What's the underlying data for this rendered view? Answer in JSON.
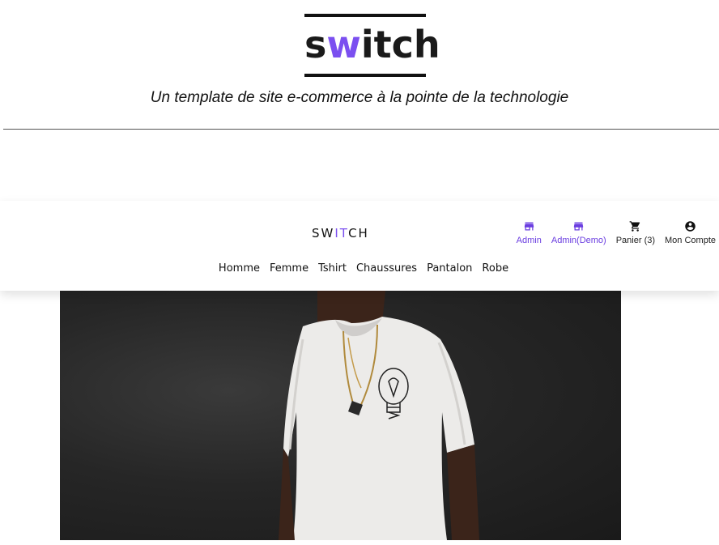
{
  "hero": {
    "logo_prefix": "s",
    "logo_accent": "w",
    "logo_suffix": "itch",
    "tagline": "Un template de site e-commerce à la pointe de la technologie"
  },
  "header": {
    "brand_prefix": "SW",
    "brand_accent": "IT",
    "brand_suffix": "CH",
    "actions": [
      {
        "label": "Admin",
        "icon": "store-icon"
      },
      {
        "label": "Admin(Demo)",
        "icon": "store-icon"
      },
      {
        "label": "Panier (3)",
        "icon": "cart-icon"
      },
      {
        "label": "Mon Compte",
        "icon": "account-circle-icon"
      }
    ],
    "nav": [
      "Homme",
      "Femme",
      "Tshirt",
      "Chaussures",
      "Pantalon",
      "Robe"
    ]
  },
  "colors": {
    "accent": "#7b4ff0",
    "admin_link": "#6a3de0",
    "banner_bg": "#262626"
  }
}
